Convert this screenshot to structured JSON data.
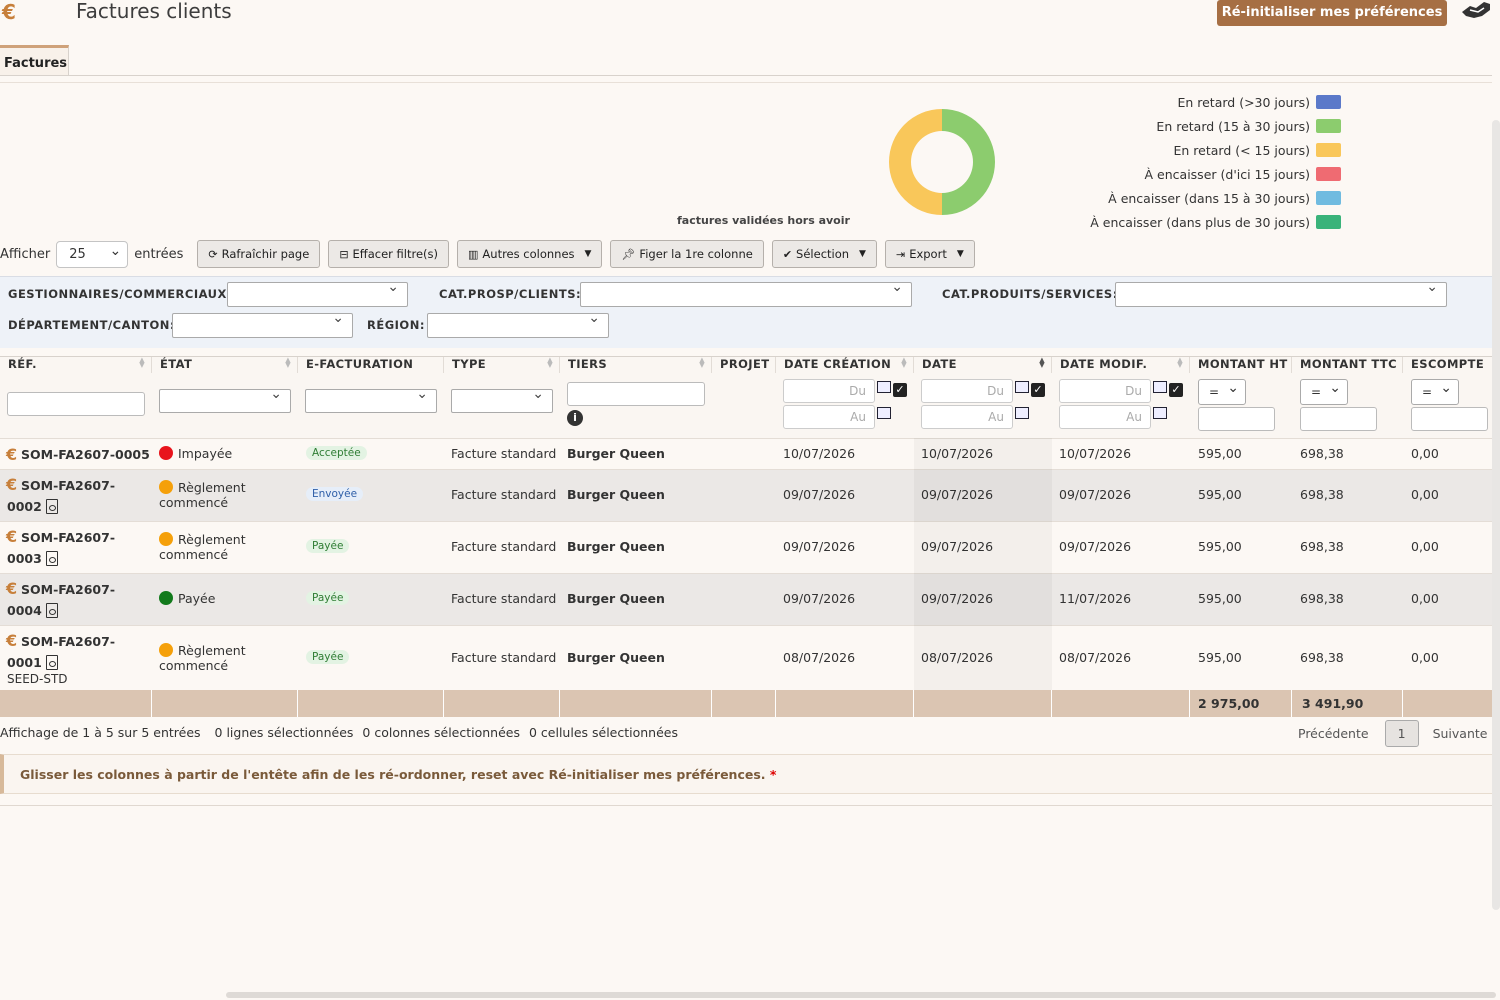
{
  "header": {
    "logo": "€",
    "title": "Factures clients",
    "reset_button": "Ré-initialiser mes préférences"
  },
  "tabs": [
    {
      "label": "Factures"
    }
  ],
  "chart_data": {
    "type": "pie",
    "title": "factures validées hors avoir",
    "categories": [
      "En retard (>30 jours)",
      "En retard (15 à 30 jours)",
      "En retard (< 15 jours)",
      "À encaisser (d'ici 15 jours)",
      "À encaisser (dans 15 à 30 jours)",
      "À encaisser (dans plus de 30 jours)"
    ],
    "values": [
      0,
      50,
      50,
      0,
      0,
      0
    ],
    "colors": [
      "#5b79c9",
      "#8ccc6e",
      "#f9c75a",
      "#ef6b72",
      "#70bbe0",
      "#3ab37a"
    ],
    "legend_position": "right"
  },
  "toolbar": {
    "show_label": "Afficher",
    "page_length": "25",
    "entries_label": "entrées",
    "buttons": [
      {
        "label": "Rafraîchir page",
        "icon": "refresh-icon"
      },
      {
        "label": "Effacer filtre(s)",
        "icon": "minus-square-icon"
      },
      {
        "label": "Autres colonnes",
        "icon": "columns-icon",
        "dropdown": true
      },
      {
        "label": "Figer la 1re colonne",
        "icon": "pin-icon"
      },
      {
        "label": "Sélection",
        "icon": "check-icon",
        "dropdown": true
      },
      {
        "label": "Export",
        "icon": "export-icon",
        "dropdown": true
      }
    ]
  },
  "filters": {
    "gestionnaires": "GESTIONNAIRES/COMMERCIAUX:",
    "cat_clients": "CAT.PROSP/CLIENTS:",
    "cat_produits": "CAT.PRODUITS/SERVICES:",
    "departement": "DÉPARTEMENT/CANTON:",
    "region": "RÉGION:"
  },
  "columns": [
    "RÉF.",
    "ÉTAT",
    "E-FACTURATION",
    "TYPE",
    "TIERS",
    "PROJET",
    "DATE CRÉATION",
    "DATE",
    "DATE MODIF.",
    "MONTANT HT",
    "MONTANT TTC",
    "ESCOMPTE"
  ],
  "column_filters": {
    "du": "Du",
    "au": "Au",
    "op": "="
  },
  "rows": [
    {
      "ref1": "SOM-FA2607-0005",
      "ref2": "",
      "ref3": "",
      "etat1": "Impayée",
      "etat2": "",
      "etat_color": "#e8141c",
      "efact": "Acceptée",
      "efact_style": "green",
      "type": "Facture standard",
      "tiers": "Burger Queen",
      "date_creation": "10/07/2026",
      "date": "10/07/2026",
      "date_modif": "10/07/2026",
      "ht": "595,00",
      "ttc": "698,38",
      "escompte": "0,00"
    },
    {
      "ref1": "SOM-FA2607-",
      "ref2": "0002",
      "ref3": "",
      "etat1": "Règlement",
      "etat2": "commencé",
      "etat_color": "#f5a00a",
      "efact": "Envoyée",
      "efact_style": "blue",
      "type": "Facture standard",
      "tiers": "Burger Queen",
      "date_creation": "09/07/2026",
      "date": "09/07/2026",
      "date_modif": "09/07/2026",
      "ht": "595,00",
      "ttc": "698,38",
      "escompte": "0,00"
    },
    {
      "ref1": "SOM-FA2607-",
      "ref2": "0003",
      "ref3": "",
      "etat1": "Règlement",
      "etat2": "commencé",
      "etat_color": "#f5a00a",
      "efact": "Payée",
      "efact_style": "green",
      "type": "Facture standard",
      "tiers": "Burger Queen",
      "date_creation": "09/07/2026",
      "date": "09/07/2026",
      "date_modif": "09/07/2026",
      "ht": "595,00",
      "ttc": "698,38",
      "escompte": "0,00"
    },
    {
      "ref1": "SOM-FA2607-",
      "ref2": "0004",
      "ref3": "",
      "etat1": "Payée",
      "etat2": "",
      "etat_color": "#127a1c",
      "efact": "Payée",
      "efact_style": "green",
      "type": "Facture standard",
      "tiers": "Burger Queen",
      "date_creation": "09/07/2026",
      "date": "09/07/2026",
      "date_modif": "11/07/2026",
      "ht": "595,00",
      "ttc": "698,38",
      "escompte": "0,00"
    },
    {
      "ref1": "SOM-FA2607-",
      "ref2": "0001",
      "ref3": "SEED-STD",
      "etat1": "Règlement",
      "etat2": "commencé",
      "etat_color": "#f5a00a",
      "efact": "Payée",
      "efact_style": "green",
      "type": "Facture standard",
      "tiers": "Burger Queen",
      "date_creation": "08/07/2026",
      "date": "08/07/2026",
      "date_modif": "08/07/2026",
      "ht": "595,00",
      "ttc": "698,38",
      "escompte": "0,00"
    }
  ],
  "totals": {
    "ht": "2 975,00",
    "ttc": "3 491,90"
  },
  "footer": {
    "info": "Affichage de 1 à 5 sur 5 entrées",
    "selected_rows": "0 lignes sélectionnées",
    "selected_cols": "0 colonnes sélectionnées",
    "selected_cells": "0 cellules sélectionnées",
    "prev": "Précédente",
    "page": "1",
    "next": "Suivante"
  },
  "note": {
    "text": "Glisser les colonnes à partir de l'entête afin de les ré-ordonner, reset avec Ré-initialiser mes préférences.",
    "star": "*"
  }
}
